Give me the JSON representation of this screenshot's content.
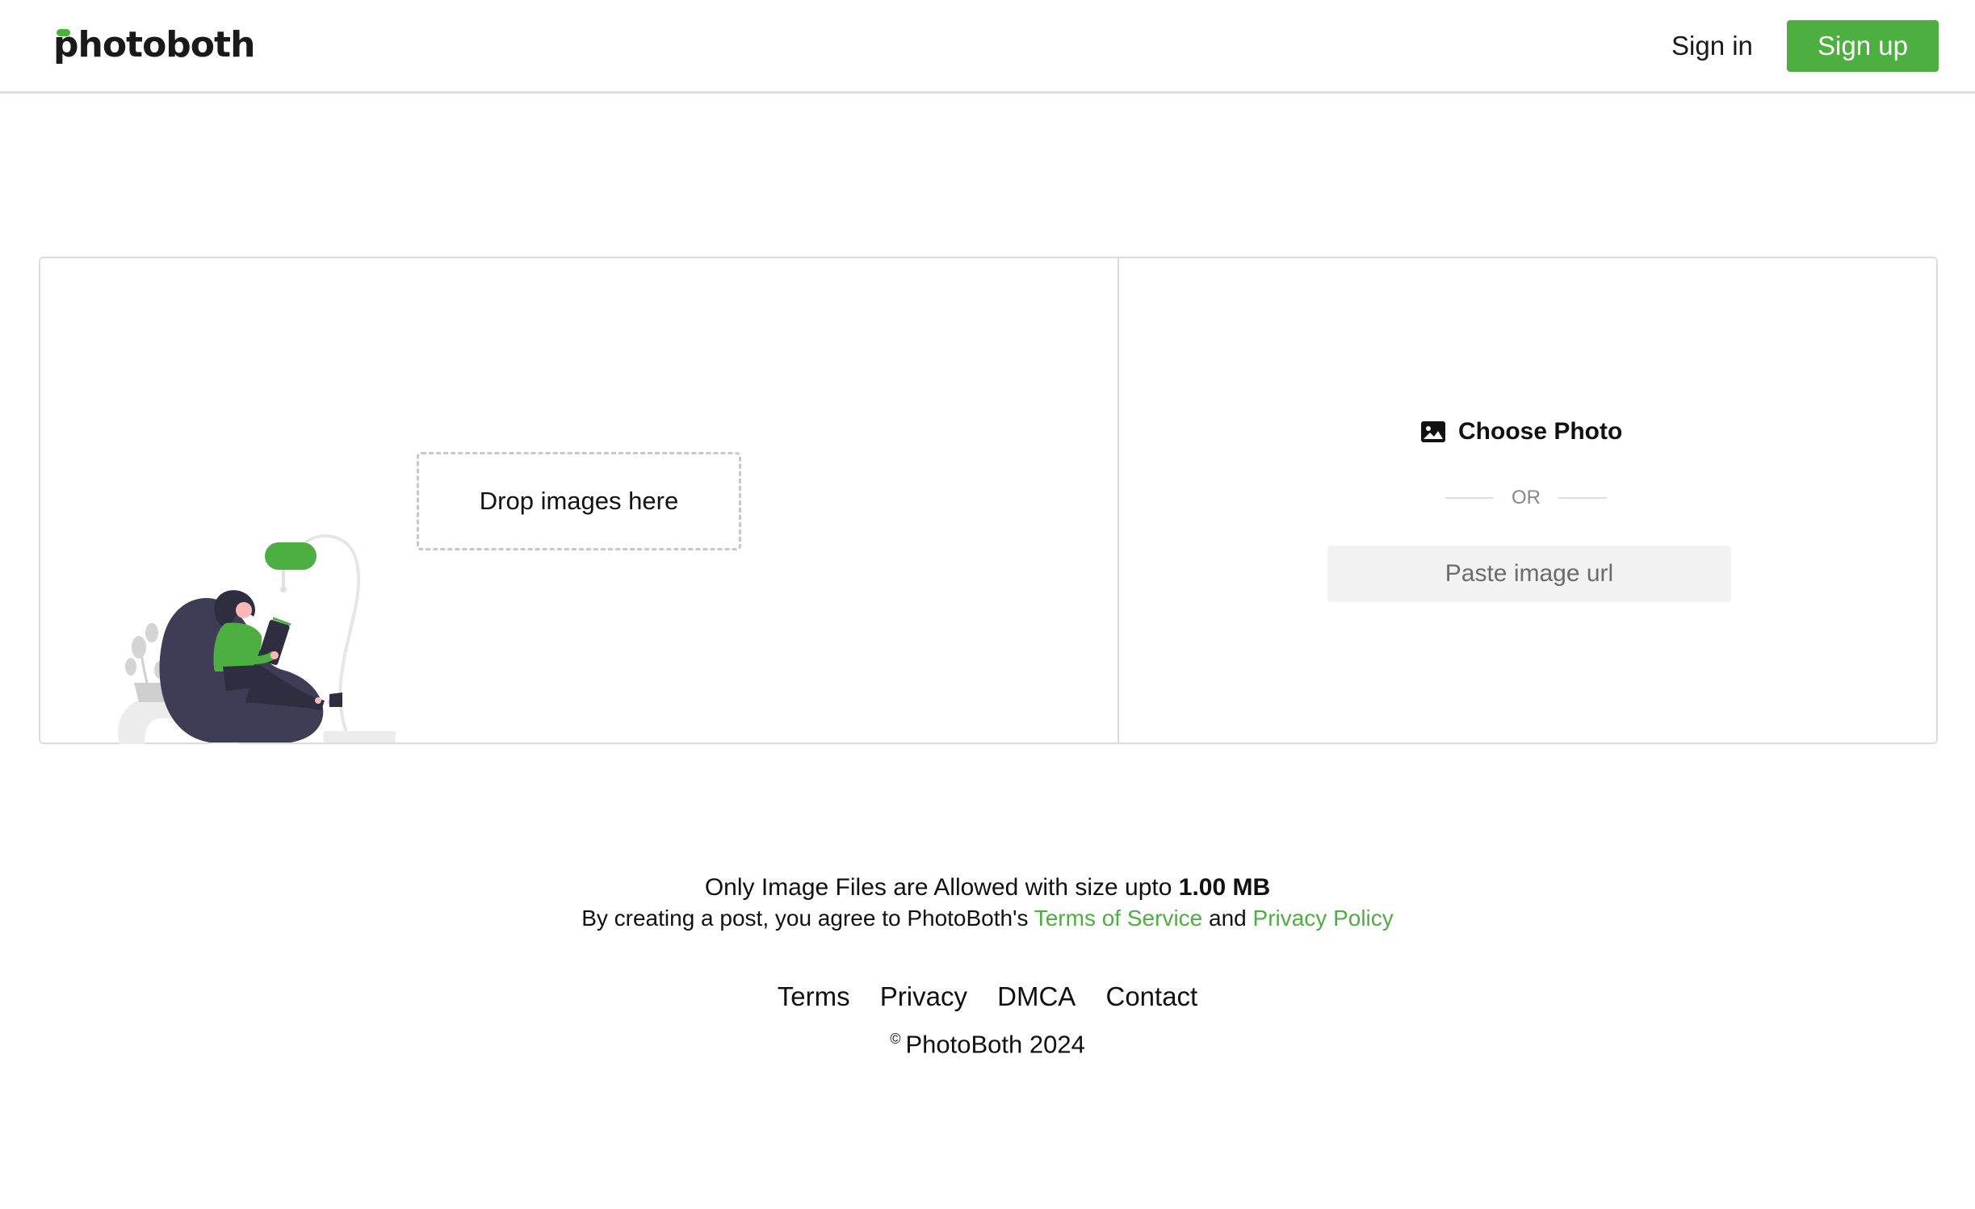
{
  "header": {
    "logo_text": "photoboth",
    "signin_label": "Sign in",
    "signup_label": "Sign up"
  },
  "upload": {
    "drop_label": "Drop images here",
    "choose_label": "Choose Photo",
    "or_label": "OR",
    "url_placeholder": "Paste image url"
  },
  "notice": {
    "line1_prefix": "Only Image Files are Allowed with size upto",
    "max_size": "1.00 MB",
    "line2_prefix": "By creating a post, you agree to PhotoBoth's",
    "terms_link": "Terms of Service",
    "and_text": "and",
    "privacy_link": "Privacy Policy"
  },
  "footer": {
    "links": [
      "Terms",
      "Privacy",
      "DMCA",
      "Contact"
    ],
    "copyright_symbol": "©",
    "copyright_text": "PhotoBoth 2024"
  },
  "colors": {
    "accent": "#4caf3f",
    "border": "#dcdcdc",
    "input_bg": "#f2f2f2"
  },
  "icons": {
    "choose_photo": "photo-icon"
  }
}
